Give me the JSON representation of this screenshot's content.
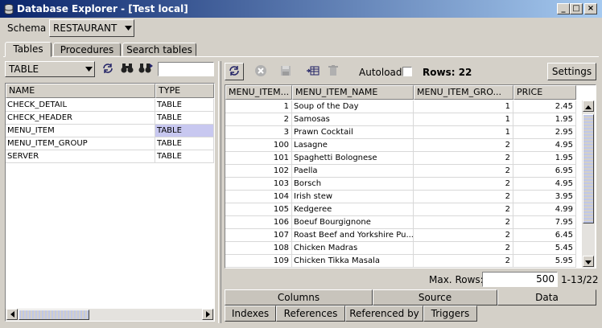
{
  "window": {
    "title": "Database Explorer - [Test local]"
  },
  "schema": {
    "label": "Schema",
    "value": "RESTAURANT"
  },
  "top_tabs": [
    {
      "label": "Tables"
    },
    {
      "label": "Procedures"
    },
    {
      "label": "Search tables"
    }
  ],
  "filter": {
    "type_value": "TABLE",
    "search_value": ""
  },
  "tables_list": {
    "columns": [
      "NAME",
      "TYPE"
    ],
    "rows": [
      {
        "name": "CHECK_DETAIL",
        "type": "TABLE"
      },
      {
        "name": "CHECK_HEADER",
        "type": "TABLE"
      },
      {
        "name": "MENU_ITEM",
        "type": "TABLE"
      },
      {
        "name": "MENU_ITEM_GROUP",
        "type": "TABLE"
      },
      {
        "name": "SERVER",
        "type": "TABLE"
      }
    ],
    "selected_index": 2
  },
  "toolbar": {
    "autoload_label": "Autoload",
    "rows_label": "Rows: 22",
    "settings_label": "Settings"
  },
  "data_grid": {
    "columns": [
      "MENU_ITEM...",
      "MENU_ITEM_NAME",
      "MENU_ITEM_GRO...",
      "PRICE"
    ],
    "rows": [
      [
        "1",
        "Soup of the Day",
        "1",
        "2.45"
      ],
      [
        "2",
        "Samosas",
        "1",
        "1.95"
      ],
      [
        "3",
        "Prawn Cocktail",
        "1",
        "2.95"
      ],
      [
        "100",
        "Lasagne",
        "2",
        "4.95"
      ],
      [
        "101",
        "Spaghetti Bolognese",
        "2",
        "1.95"
      ],
      [
        "102",
        "Paella",
        "2",
        "6.95"
      ],
      [
        "103",
        "Borsch",
        "2",
        "4.95"
      ],
      [
        "104",
        "Irish stew",
        "2",
        "3.95"
      ],
      [
        "105",
        "Kedgeree",
        "2",
        "4.99"
      ],
      [
        "106",
        "Boeuf Bourgignone",
        "2",
        "7.95"
      ],
      [
        "107",
        "Roast Beef and Yorkshire Pu...",
        "2",
        "6.45"
      ],
      [
        "108",
        "Chicken Madras",
        "2",
        "5.45"
      ],
      [
        "109",
        "Chicken Tikka Masala",
        "2",
        "5.95"
      ]
    ]
  },
  "footer": {
    "max_rows_label": "Max. Rows:",
    "max_rows_value": "500",
    "range": "1-13/22"
  },
  "bottom_tabs_row1": [
    {
      "label": "Columns"
    },
    {
      "label": "Source"
    },
    {
      "label": "Data"
    }
  ],
  "bottom_tabs_row2": [
    {
      "label": "Indexes"
    },
    {
      "label": "References"
    },
    {
      "label": "Referenced by"
    },
    {
      "label": "Triggers"
    }
  ],
  "colors": {
    "title_start": "#0a246a",
    "title_end": "#a6caf0",
    "selection": "#c8c8f0",
    "chrome": "#d4d0c8"
  }
}
